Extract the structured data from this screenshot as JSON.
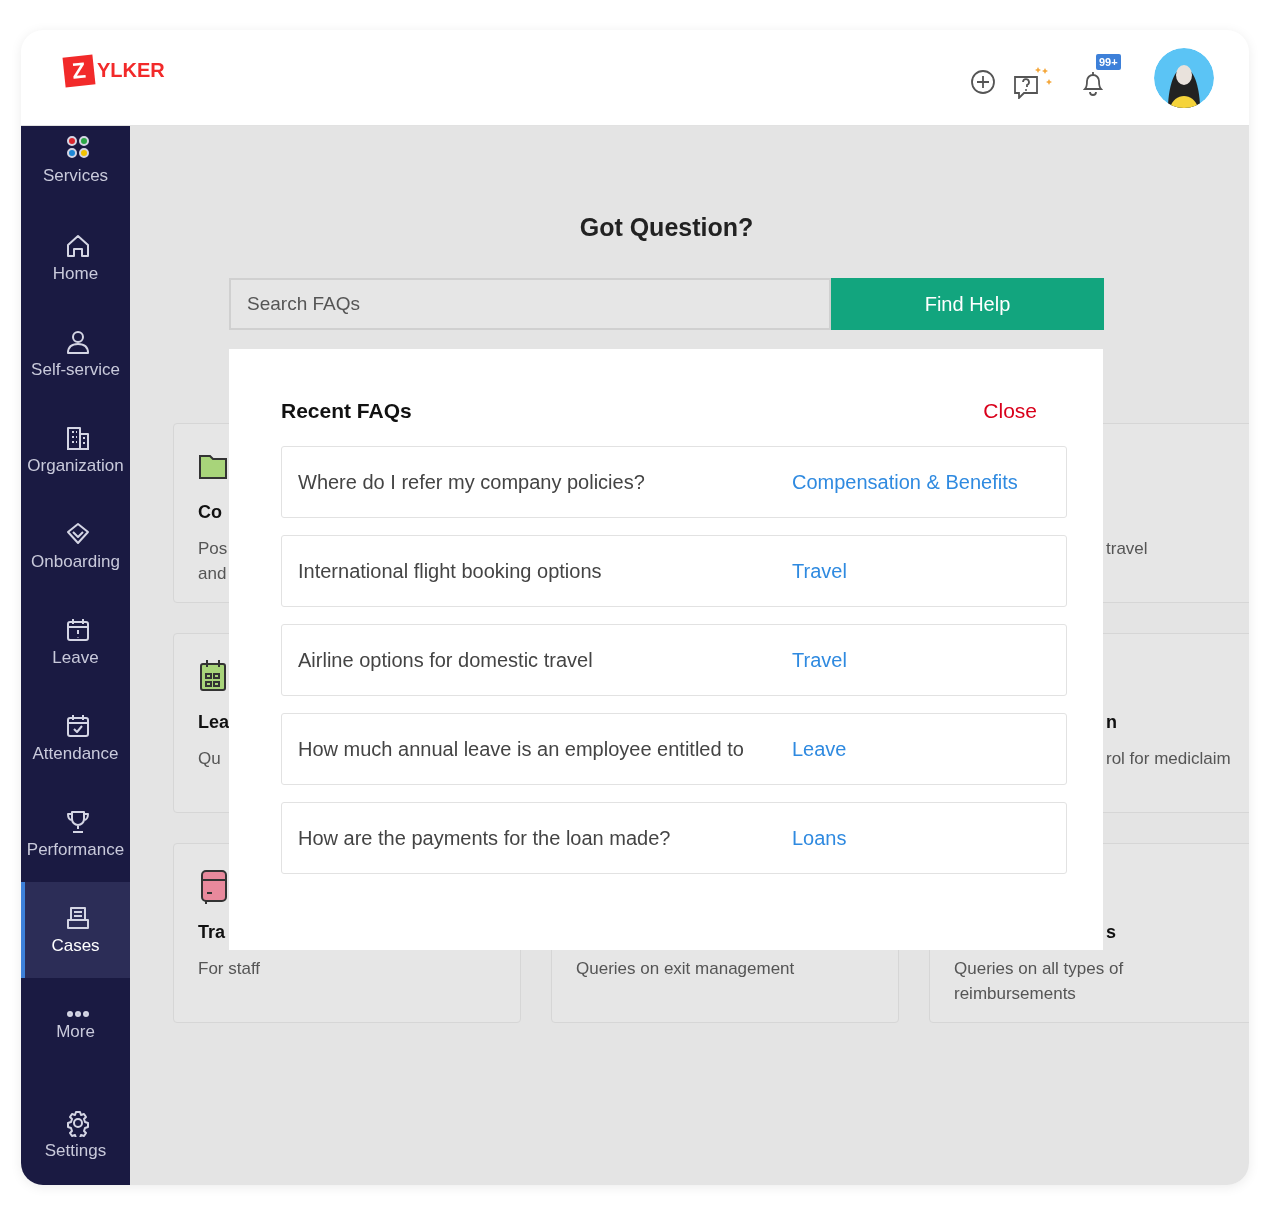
{
  "header": {
    "logo": {
      "mark": "Z",
      "word": "YLKER"
    },
    "notification_badge": "99+"
  },
  "sidebar": {
    "items": [
      {
        "label": "Services",
        "selected": false
      },
      {
        "label": "Home",
        "selected": false
      },
      {
        "label": "Self-service",
        "selected": false
      },
      {
        "label": "Organization",
        "selected": false
      },
      {
        "label": "Onboarding",
        "selected": false
      },
      {
        "label": "Leave",
        "selected": false
      },
      {
        "label": "Attendance",
        "selected": false
      },
      {
        "label": "Performance",
        "selected": false
      },
      {
        "label": "Cases",
        "selected": true
      },
      {
        "label": "More",
        "selected": false
      }
    ],
    "footer_item": {
      "label": "Settings",
      "selected": false
    }
  },
  "main": {
    "title": "Got Question?",
    "search": {
      "placeholder": "Search FAQs",
      "button": "Find Help"
    },
    "card_rows": [
      [
        {
          "title": "Co",
          "description": [
            "Pos",
            "and"
          ],
          "hidden_start": false
        },
        null,
        {
          "description": [
            "travel"
          ],
          "hidden_start": true
        }
      ],
      [
        {
          "title": "Lea",
          "description": [
            "Qu"
          ],
          "hidden_start": false
        },
        null,
        {
          "title": "n",
          "description": [
            "rol for mediclaim"
          ],
          "hidden_start": true
        }
      ],
      [
        {
          "title": "Tra",
          "description": [
            "For staff"
          ],
          "hidden_start": false
        },
        {
          "description": [
            "Queries on exit management"
          ],
          "hidden_start": false
        },
        {
          "title": "s",
          "description": [
            "Queries on all types of",
            "reimbursements"
          ],
          "hidden_start": false,
          "title_hidden_start": true
        }
      ]
    ]
  },
  "faq_panel": {
    "title": "Recent FAQs",
    "close": "Close",
    "items": [
      {
        "question": "Where do I refer my company policies?",
        "category": "Compensation & Benefits"
      },
      {
        "question": "International flight booking options",
        "category": "Travel"
      },
      {
        "question": "Airline options for domestic travel",
        "category": "Travel"
      },
      {
        "question": "How much annual leave is an employee entitled to",
        "category": "Leave"
      },
      {
        "question": "How are the payments for the loan made?",
        "category": "Loans"
      }
    ]
  }
}
